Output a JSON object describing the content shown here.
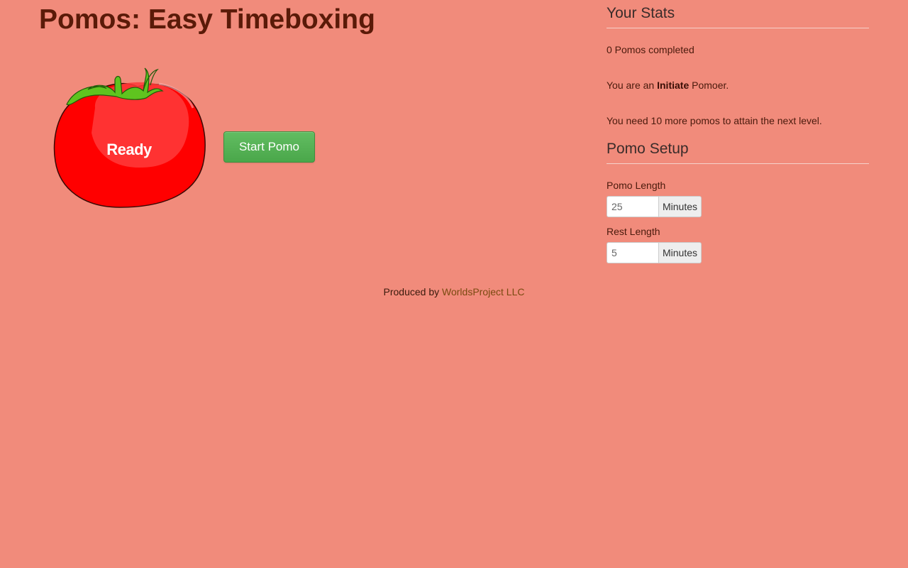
{
  "header": {
    "title": "Pomos: Easy Timeboxing"
  },
  "timer": {
    "status": "Ready",
    "start_label": "Start Pomo"
  },
  "stats": {
    "title": "Your Stats",
    "completed_text": "0 Pomos completed",
    "level_prefix": "You are an ",
    "level_name": "Initiate",
    "level_suffix": " Pomoer.",
    "next_level_text": "You need 10 more pomos to attain the next level."
  },
  "setup": {
    "title": "Pomo Setup",
    "pomo_length": {
      "label": "Pomo Length",
      "value": "25",
      "unit": "Minutes"
    },
    "rest_length": {
      "label": "Rest Length",
      "value": "5",
      "unit": "Minutes"
    }
  },
  "footer": {
    "prefix": "Produced by ",
    "link_text": "WorldsProject LLC"
  },
  "colors": {
    "background": "#f18b7b",
    "tomato": "#ff0000",
    "button": "#5cb85c"
  }
}
